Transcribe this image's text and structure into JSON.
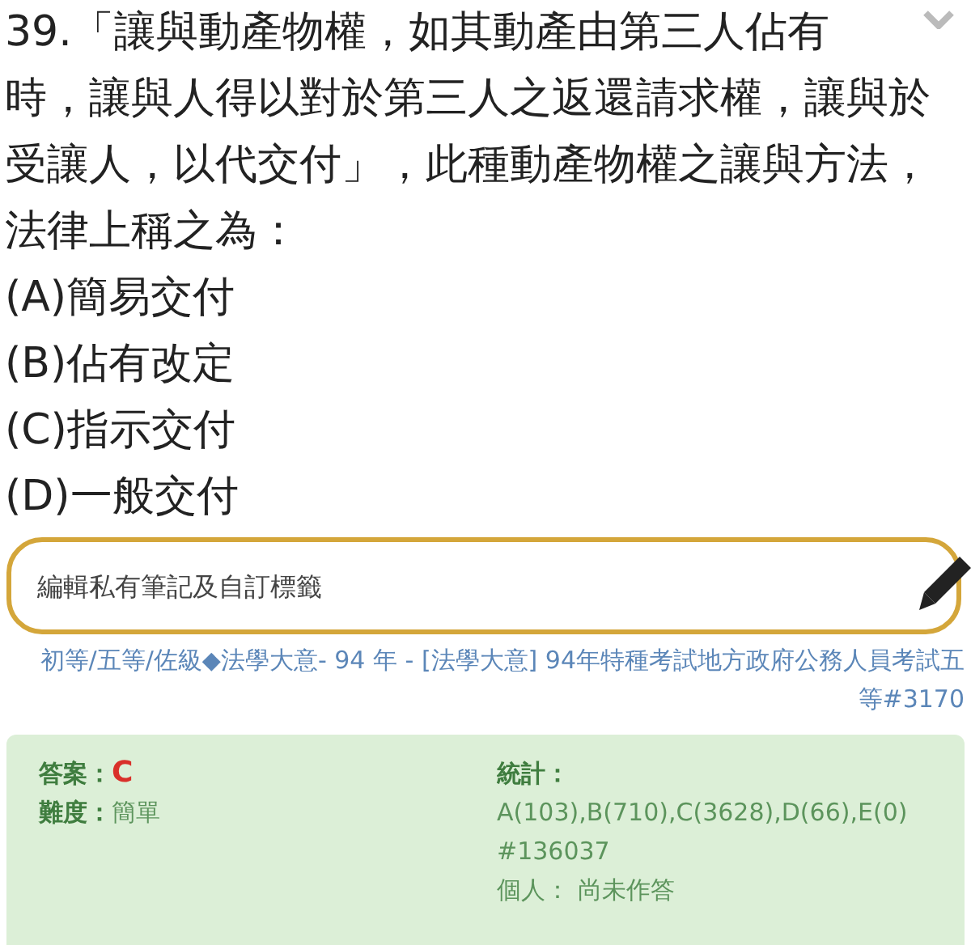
{
  "question": {
    "text": "39.「讓與動產物權，如其動產由第三人佔有時，讓與人得以對於第三人之返還請求權，讓與於受讓人，以代交付」，此種動產物權之讓與方法，法律上稱之為：",
    "expanded": false
  },
  "options": [
    {
      "text": "(A)簡易交付"
    },
    {
      "text": "(B)佔有改定"
    },
    {
      "text": "(C)指示交付"
    },
    {
      "text": "(D)一般交付"
    }
  ],
  "note": {
    "placeholder": "編輯私有筆記及自訂標籤"
  },
  "source": {
    "category": "初等/五等/佐級",
    "separator": "◆",
    "rest": "法學大意- 94 年 - [法學大意] 94年特種考試地方政府公務人員考試五等#3170"
  },
  "info": {
    "answer_label": "答案：",
    "answer": "C",
    "difficulty_label": "難度：",
    "difficulty": "簡單",
    "stats_label": "統計：",
    "stats": "A(103),B(710),C(3628),D(66),E(0)",
    "id": "#136037",
    "personal_label": "個人：",
    "personal": "尚未作答"
  }
}
